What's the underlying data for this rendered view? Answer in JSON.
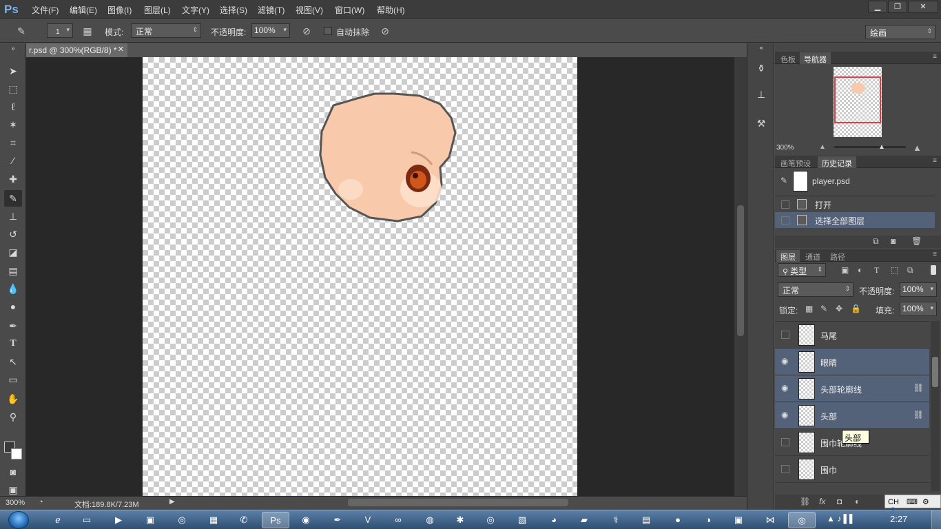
{
  "app": {
    "logo": "Ps"
  },
  "menu": [
    "文件(F)",
    "编辑(E)",
    "图像(I)",
    "图层(L)",
    "文字(Y)",
    "选择(S)",
    "滤镜(T)",
    "视图(V)",
    "窗口(W)",
    "帮助(H)"
  ],
  "window_controls": {
    "minimize": "▁",
    "restore": "❐",
    "close": "✕"
  },
  "options": {
    "brush_size": "1",
    "mode_label": "模式:",
    "mode_value": "正常",
    "opacity_label": "不透明度:",
    "opacity_value": "100%",
    "auto_erase_label": "自动抹除",
    "workspace_value": "绘画"
  },
  "document": {
    "tab_title": "r.psd @ 300%(RGB/8) *",
    "status_zoom": "300%",
    "status_doc": "文档:189.8K/7.23M"
  },
  "navigator": {
    "tabs": [
      "色板",
      "导航器"
    ],
    "zoom": "300%"
  },
  "history": {
    "tabs": [
      "画笔预设",
      "历史记录"
    ],
    "snapshot": "player.psd",
    "items": [
      "打开",
      "选择全部图层"
    ]
  },
  "layers": {
    "tabs": [
      "图层",
      "通道",
      "路径"
    ],
    "filter_label": "类型",
    "blend_mode": "正常",
    "opacity_label": "不透明度:",
    "opacity_value": "100%",
    "lock_label": "锁定:",
    "fill_label": "填充:",
    "fill_value": "100%",
    "items": [
      {
        "name": "马尾",
        "visible": false,
        "selected": false,
        "linked": false
      },
      {
        "name": "眼睛",
        "visible": true,
        "selected": true,
        "linked": false
      },
      {
        "name": "头部轮廓线",
        "visible": true,
        "selected": true,
        "linked": true
      },
      {
        "name": "头部",
        "visible": true,
        "selected": true,
        "linked": true
      },
      {
        "name": "围巾轮廓线",
        "visible": false,
        "selected": false,
        "linked": false
      },
      {
        "name": "围巾",
        "visible": false,
        "selected": false,
        "linked": false
      }
    ],
    "tooltip": "头部"
  },
  "taskbar": {
    "lang": "CH",
    "clock": "2:27"
  },
  "colors": {
    "accent": "#536278",
    "skin": "#f9c9ab",
    "outline": "#555555"
  }
}
